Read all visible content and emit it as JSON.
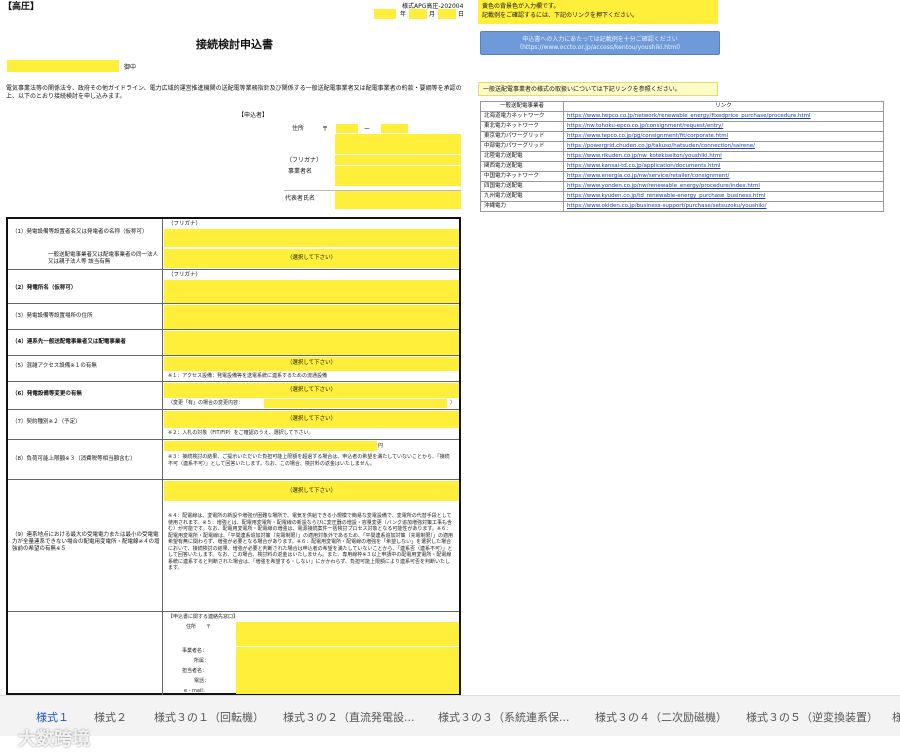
{
  "header": {
    "hv_label": "【高圧】",
    "form_code": "様式APG高圧-202004",
    "date_year": "年",
    "date_month": "月",
    "date_day": "日",
    "title": "接続検討申込書",
    "addressee_suffix": "御中",
    "intro": "電気事業法等の関係法令、政府その他ガイドライン、電力広域的運営推進機関の送配電等業務指針及び関係する一般送配電事業者又は配電事業者の約款・要綱等を承認の上、以下のとおり接続検討を申し込みます。"
  },
  "applicant": {
    "section": "【申込者】",
    "address": "住所",
    "postal_mark": "〒",
    "dash": "ー",
    "furigana": "（フリガナ）",
    "company": "事業者名",
    "rep": "代表者氏名"
  },
  "notice": {
    "line1": "黄色の背景色が入力欄です。",
    "line2": "記載例をご確認するには、下記のリンクを押下ください。",
    "button_line1": "申込書への入力にあたっては記載例を十分ご確認ください",
    "button_line2": "（https://www.occto.or.jp/access/kentou/youshiki.html）"
  },
  "links_section": {
    "caption": "一般送配電事業者の様式の取扱いについては下記リンクを参照ください。",
    "col_company": "一般送配電事業者",
    "col_link": "リンク",
    "rows": [
      {
        "company": "北海道電力ネットワーク",
        "url": "https://www.hepco.co.jp/network/renewable_energy/fixedprice_purchase/procedure.html"
      },
      {
        "company": "東北電力ネットワーク",
        "url": "https://nw.tohoku-epco.co.jp/consignment/request/entry/"
      },
      {
        "company": "東京電力パワーグリッド",
        "url": "https://www.tepco.co.jp/pg/consignment/fit/corporate.html"
      },
      {
        "company": "中部電力パワーグリッド",
        "url": "https://powergrid.chuden.co.jp/takuso/hatsuden/connection/sairene/"
      },
      {
        "company": "北陸電力送配電",
        "url": "https://www.rikuden.co.jp/nw_kotekiseiton/youshiki.html"
      },
      {
        "company": "関西電力送配電",
        "url": "https://www.kansai-td.co.jp/application/documents.html"
      },
      {
        "company": "中国電力ネットワーク",
        "url": "https://www.energia.co.jp/nw/service/retailer/consignment/"
      },
      {
        "company": "四国電力送配電",
        "url": "https://www.yonden.co.jp/nw/renewable_energy/procedure/index.html"
      },
      {
        "company": "九州電力送配電",
        "url": "https://www.kyuden.co.jp/td_renewable-energy_purchase_business.html"
      },
      {
        "company": "沖縄電力",
        "url": "https://www.okiden.co.jp/business-support/purchase/setsuzoku/youshiki/"
      }
    ]
  },
  "form": {
    "r1_label": "（1）発電設備等設置者名又は発電者の名称（仮称可）",
    "r1_sub": "一般送配電事業者又は配電事業者の同一法人又は親子法人等 該当有無",
    "furigana": "（フリガナ）",
    "select": "（選択して下さい）",
    "r2_label": "（2）発電所名（仮称可）",
    "r3_label": "（3）発電設備等設置場所の住所",
    "r4_label": "（4）連系先一般送配電事業者又は配電事業者",
    "r5_label": "（5）混雑アクセス設備※１の有無",
    "r5_note": "※１：アクセス設備：発電設備等を送電系統に連系するための流通設備",
    "r6_label": "（6）発電設備等変更の有無",
    "r6_note": "（変更「有」の場合の変更内容：",
    "r6_paren": "）",
    "r7_label": "（7）契約種別※２（予定）",
    "r7_note": "※２：入札の対象（FIT/FIP）をご確認のうえ、選択して下さい。",
    "r8_label": "（8）負荷可能上限額※３（消費税等相当額含む）",
    "r8_unit": "円",
    "r8_note": "※３：接続検討の結果、ご提示いただいた負担可能上限額を超過する場合は、申込者の希望を満たしていないことから、「接続不可（連系不可）」として回答いたします。なお、この場合、検討料の返金はいたしません。",
    "r9_label": "（9）連系地点における最大の受電電力または最小の受電電力が全量連系できない場合の配電用変電所・配電線※４の增強前の希望の有無※５",
    "r9_note": "※４：配電線は、変電所の新設や増強が困難な場所で、電気を供給できる小規模で簡易な変電設備で、変電所の代替手段として使用されます。※５：増強とは、配電用変電所・配電線の新設ならびに変圧器の増設・容量変更（バンク追加増強対策工事も含む）が可能です。なお、配電用変電所・配電線の増強は、電源接続案件一括検討プロセス対象となる可能性があります。※６：配電用変電所・配電線は、「平間連系追加対策（充電制限）」の適用対象外であるため、「平間連系追加対策（充電制限）」の適用希望有無に関わらず、増強が必要となる場合があります。※６：配電用変電所・配電線の増強を「希望しない」を選択した場合において、接続検討の結果、増強が必要と判断された場合は申込者の希望を満たしていないことから、「連系否（連系不可）」として回答いたします。なお、この場合、検討料の返金はいたしません。また、専用線枠※３以上申請中の配電用変電所・配電線系統に連系すると判断された場合は、「増強を希望する・しない」にかかわらず、負担可能上限額により連系可否を判断いたします。",
    "contact_header": "【申込書に関する連絡先窓口】",
    "contact_address": "住所",
    "contact_postal": "〒",
    "contact_company": "事業者名：",
    "contact_dept": "所属：",
    "contact_person": "担当者名：",
    "contact_tel": "電話：",
    "contact_email": "e - mail："
  },
  "tabs": [
    "様式１",
    "様式２",
    "様式３の１（回転機）",
    "様式３の２（直流発電設...",
    "様式３の３（系統連系保...",
    "様式３の４（二次励磁機）",
    "様式３の５（逆変換装置）",
    "様"
  ],
  "watermark": "大数跨境",
  "colors": {
    "input_yellow": "#ffef3a",
    "link_blue": "#1a3ea8",
    "active_tab": "#1f55c8"
  }
}
